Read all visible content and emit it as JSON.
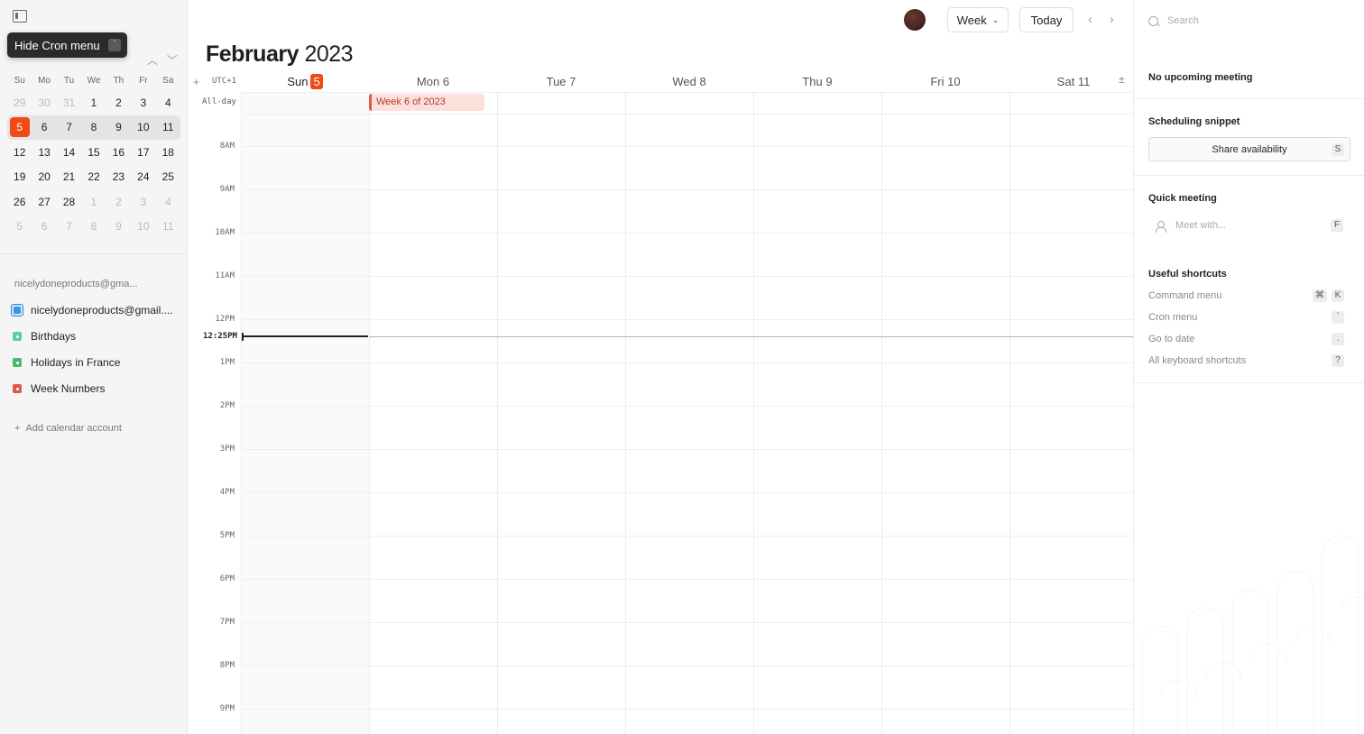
{
  "tooltip": {
    "label": "Hide Cron menu",
    "key": "`"
  },
  "mini_calendar": {
    "weekdays": [
      "Su",
      "Mo",
      "Tu",
      "We",
      "Th",
      "Fr",
      "Sa"
    ],
    "rows": [
      [
        "29",
        "30",
        "31",
        "1",
        "2",
        "3",
        "4"
      ],
      [
        "5",
        "6",
        "7",
        "8",
        "9",
        "10",
        "11"
      ],
      [
        "12",
        "13",
        "14",
        "15",
        "16",
        "17",
        "18"
      ],
      [
        "19",
        "20",
        "21",
        "22",
        "23",
        "24",
        "25"
      ],
      [
        "26",
        "27",
        "28",
        "1",
        "2",
        "3",
        "4"
      ],
      [
        "5",
        "6",
        "7",
        "8",
        "9",
        "10",
        "11"
      ]
    ]
  },
  "sidebar": {
    "account_label": "nicelydoneproducts@gma...",
    "calendars": [
      {
        "label": "nicelydoneproducts@gmail....",
        "color": "#2a86d9"
      },
      {
        "label": "Birthdays",
        "color": "#5fcf9a"
      },
      {
        "label": "Holidays in France",
        "color": "#4cba6a"
      },
      {
        "label": "Week Numbers",
        "color": "#e05a4a"
      }
    ],
    "add_account": "Add calendar account"
  },
  "header": {
    "month": "February",
    "year": "2023",
    "view": "Week",
    "today": "Today"
  },
  "timezone": "UTC+1",
  "allday_label": "All-day",
  "days": [
    {
      "name": "Sun",
      "num": "5"
    },
    {
      "name": "Mon",
      "num": "6"
    },
    {
      "name": "Tue",
      "num": "7"
    },
    {
      "name": "Wed",
      "num": "8"
    },
    {
      "name": "Thu",
      "num": "9"
    },
    {
      "name": "Fri",
      "num": "10"
    },
    {
      "name": "Sat",
      "num": "11"
    }
  ],
  "hours": [
    "8AM",
    "9AM",
    "10AM",
    "11AM",
    "12PM",
    "1PM",
    "2PM",
    "3PM",
    "4PM",
    "5PM",
    "6PM",
    "7PM",
    "8PM",
    "9PM"
  ],
  "now_label": "12:25PM",
  "event": {
    "title": "Week 6 of 2023"
  },
  "right_panel": {
    "search_placeholder": "Search",
    "no_meeting": "No upcoming meeting",
    "scheduling_title": "Scheduling snippet",
    "share_label": "Share availability",
    "share_key": "S",
    "quick_title": "Quick meeting",
    "meet_placeholder": "Meet with...",
    "meet_key": "F",
    "shortcuts_title": "Useful shortcuts",
    "shortcuts": [
      {
        "label": "Command menu",
        "keys": [
          "⌘",
          "K"
        ]
      },
      {
        "label": "Cron menu",
        "keys": [
          "`"
        ]
      },
      {
        "label": "Go to date",
        "keys": [
          "."
        ]
      },
      {
        "label": "All keyboard shortcuts",
        "keys": [
          "?"
        ]
      }
    ]
  },
  "colors": {
    "accent": "#f24a14",
    "event_bg": "#fce0db",
    "event_border": "#e05a4a"
  }
}
